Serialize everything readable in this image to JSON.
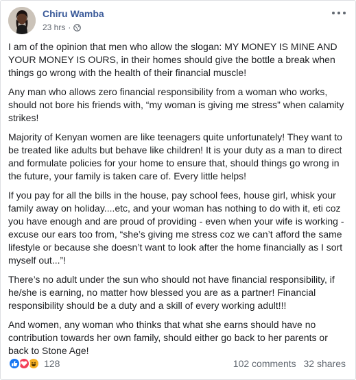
{
  "post": {
    "author": "Chiru Wamba",
    "time": "23 hrs",
    "separator": "·",
    "paragraphs": [
      "I am of the opinion that men who allow the slogan: MY MONEY IS MINE AND YOUR MONEY IS OURS, in their homes should give the bottle a break when things go wrong with the health of their financial muscle!",
      "Any man who allows zero financial responsibility from a woman who works, should not bore his friends with, “my woman is giving me stress” when calamity strikes!",
      "Majority of Kenyan women are like teenagers quite unfortunately! They want to be treated like adults but behave like children! It is your duty as a man to direct and formulate policies for your home to ensure that, should things go wrong in the future, your family is taken care of. Every little helps!",
      "If you pay for all the bills in the house, pay school fees, house girl, whisk your family away on holiday....etc, and your woman has nothing to do with it, eti coz you have enough and are proud of providing - even when your wife is working - excuse our ears too from, “she’s giving me stress coz we can’t afford the same lifestyle or because she doesn’t want to look after the home financially as I sort myself out...”!",
      "There’s no adult under the sun who should not have financial responsibility, if he/she is earning, no matter how blessed you are as a partner! Financial responsibility should be a duty and a skill of every working adult!!!",
      "And women, any woman who thinks that what she earns should have no contribution towards her own family, should either go back to her parents or back to Stone Age!"
    ]
  },
  "footer": {
    "reaction_count": "128",
    "comments": "102 comments",
    "shares": "32 shares",
    "reactions": [
      "like-icon",
      "love-icon",
      "haha-icon"
    ]
  },
  "colors": {
    "author": "#385898",
    "meta": "#616770",
    "like": "#1877f2",
    "love": "#f33e58",
    "haha": "#f7b125"
  }
}
